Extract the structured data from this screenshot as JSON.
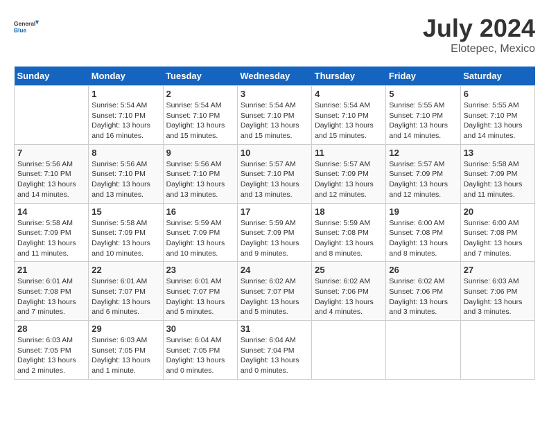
{
  "header": {
    "logo_general": "General",
    "logo_blue": "Blue",
    "month_title": "July 2024",
    "location": "Elotepec, Mexico"
  },
  "weekdays": [
    "Sunday",
    "Monday",
    "Tuesday",
    "Wednesday",
    "Thursday",
    "Friday",
    "Saturday"
  ],
  "weeks": [
    [
      {
        "day": "",
        "info": ""
      },
      {
        "day": "1",
        "info": "Sunrise: 5:54 AM\nSunset: 7:10 PM\nDaylight: 13 hours\nand 16 minutes."
      },
      {
        "day": "2",
        "info": "Sunrise: 5:54 AM\nSunset: 7:10 PM\nDaylight: 13 hours\nand 15 minutes."
      },
      {
        "day": "3",
        "info": "Sunrise: 5:54 AM\nSunset: 7:10 PM\nDaylight: 13 hours\nand 15 minutes."
      },
      {
        "day": "4",
        "info": "Sunrise: 5:54 AM\nSunset: 7:10 PM\nDaylight: 13 hours\nand 15 minutes."
      },
      {
        "day": "5",
        "info": "Sunrise: 5:55 AM\nSunset: 7:10 PM\nDaylight: 13 hours\nand 14 minutes."
      },
      {
        "day": "6",
        "info": "Sunrise: 5:55 AM\nSunset: 7:10 PM\nDaylight: 13 hours\nand 14 minutes."
      }
    ],
    [
      {
        "day": "7",
        "info": "Sunrise: 5:56 AM\nSunset: 7:10 PM\nDaylight: 13 hours\nand 14 minutes."
      },
      {
        "day": "8",
        "info": "Sunrise: 5:56 AM\nSunset: 7:10 PM\nDaylight: 13 hours\nand 13 minutes."
      },
      {
        "day": "9",
        "info": "Sunrise: 5:56 AM\nSunset: 7:10 PM\nDaylight: 13 hours\nand 13 minutes."
      },
      {
        "day": "10",
        "info": "Sunrise: 5:57 AM\nSunset: 7:10 PM\nDaylight: 13 hours\nand 13 minutes."
      },
      {
        "day": "11",
        "info": "Sunrise: 5:57 AM\nSunset: 7:09 PM\nDaylight: 13 hours\nand 12 minutes."
      },
      {
        "day": "12",
        "info": "Sunrise: 5:57 AM\nSunset: 7:09 PM\nDaylight: 13 hours\nand 12 minutes."
      },
      {
        "day": "13",
        "info": "Sunrise: 5:58 AM\nSunset: 7:09 PM\nDaylight: 13 hours\nand 11 minutes."
      }
    ],
    [
      {
        "day": "14",
        "info": "Sunrise: 5:58 AM\nSunset: 7:09 PM\nDaylight: 13 hours\nand 11 minutes."
      },
      {
        "day": "15",
        "info": "Sunrise: 5:58 AM\nSunset: 7:09 PM\nDaylight: 13 hours\nand 10 minutes."
      },
      {
        "day": "16",
        "info": "Sunrise: 5:59 AM\nSunset: 7:09 PM\nDaylight: 13 hours\nand 10 minutes."
      },
      {
        "day": "17",
        "info": "Sunrise: 5:59 AM\nSunset: 7:09 PM\nDaylight: 13 hours\nand 9 minutes."
      },
      {
        "day": "18",
        "info": "Sunrise: 5:59 AM\nSunset: 7:08 PM\nDaylight: 13 hours\nand 8 minutes."
      },
      {
        "day": "19",
        "info": "Sunrise: 6:00 AM\nSunset: 7:08 PM\nDaylight: 13 hours\nand 8 minutes."
      },
      {
        "day": "20",
        "info": "Sunrise: 6:00 AM\nSunset: 7:08 PM\nDaylight: 13 hours\nand 7 minutes."
      }
    ],
    [
      {
        "day": "21",
        "info": "Sunrise: 6:01 AM\nSunset: 7:08 PM\nDaylight: 13 hours\nand 7 minutes."
      },
      {
        "day": "22",
        "info": "Sunrise: 6:01 AM\nSunset: 7:07 PM\nDaylight: 13 hours\nand 6 minutes."
      },
      {
        "day": "23",
        "info": "Sunrise: 6:01 AM\nSunset: 7:07 PM\nDaylight: 13 hours\nand 5 minutes."
      },
      {
        "day": "24",
        "info": "Sunrise: 6:02 AM\nSunset: 7:07 PM\nDaylight: 13 hours\nand 5 minutes."
      },
      {
        "day": "25",
        "info": "Sunrise: 6:02 AM\nSunset: 7:06 PM\nDaylight: 13 hours\nand 4 minutes."
      },
      {
        "day": "26",
        "info": "Sunrise: 6:02 AM\nSunset: 7:06 PM\nDaylight: 13 hours\nand 3 minutes."
      },
      {
        "day": "27",
        "info": "Sunrise: 6:03 AM\nSunset: 7:06 PM\nDaylight: 13 hours\nand 3 minutes."
      }
    ],
    [
      {
        "day": "28",
        "info": "Sunrise: 6:03 AM\nSunset: 7:05 PM\nDaylight: 13 hours\nand 2 minutes."
      },
      {
        "day": "29",
        "info": "Sunrise: 6:03 AM\nSunset: 7:05 PM\nDaylight: 13 hours\nand 1 minute."
      },
      {
        "day": "30",
        "info": "Sunrise: 6:04 AM\nSunset: 7:05 PM\nDaylight: 13 hours\nand 0 minutes."
      },
      {
        "day": "31",
        "info": "Sunrise: 6:04 AM\nSunset: 7:04 PM\nDaylight: 13 hours\nand 0 minutes."
      },
      {
        "day": "",
        "info": ""
      },
      {
        "day": "",
        "info": ""
      },
      {
        "day": "",
        "info": ""
      }
    ]
  ]
}
